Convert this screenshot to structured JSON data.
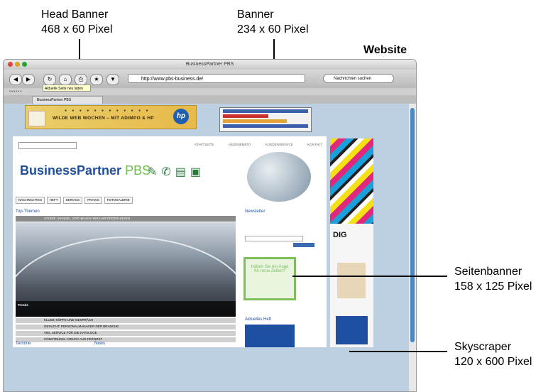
{
  "callouts": {
    "head_banner": {
      "name": "Head Banner",
      "size": "468 x 60 Pixel"
    },
    "banner": {
      "name": "Banner",
      "size": "234 x 60 Pixel"
    },
    "website": "Website",
    "seitenbanner": {
      "name": "Seitenbanner",
      "size": "158 x 125 Pixel"
    },
    "skyscraper": {
      "name": "Skyscraper",
      "size": "120 x 600 Pixel"
    }
  },
  "browser": {
    "window_title": "BusinessPartner PBS",
    "url": "http://www.pbs-business.de/",
    "search_placeholder": "Nachrichten suchen",
    "tooltip": "Aktuelle Seite neu laden",
    "tab_label": "BusinessPartner PBS"
  },
  "site": {
    "head_banner_text": "WILDE WEB WOCHEN – MIT ADIMPO & HP",
    "brand_left": "BusinessPartner",
    "brand_right": "PBS",
    "nav": [
      "NACHRICHTEN",
      "HEFT",
      "SERVICE",
      "PRAXIS",
      "FOTOGALERIE"
    ],
    "top_links": [
      "STARTSEITE",
      "ABONNEMENT",
      "KUNDENSERVICE",
      "KONTAKT"
    ],
    "top_themen": "Top-Themen",
    "headline": "STUDIE: WANDEL VOR NEUEN HERAUSFORDERUNGEN",
    "caption_title": "Trends",
    "list_items": [
      "KLUGE KÖPFE UND GESPRÄCH",
      "GESUCHT: PERSONALMANAGER DER BRANCHE",
      "VIEL SERVICE FÜR DIE KATALOGE",
      "CONSTRUKEL: DRUCK AUS FERNOST"
    ],
    "newsletter": "Newsletter",
    "aktuelles_heft": "Aktuelles Heft",
    "termine": "Termine",
    "news": "News",
    "dig_logo": "DIG",
    "side_banner_text": "Haben Sie ein Auge für neue Zeiten?"
  },
  "colors": {
    "brand_blue": "#1f4fa0",
    "brand_green": "#6cc04a",
    "sidebanner_border": "#7cbf5c",
    "headbanner_gold": "#e7b94a"
  }
}
